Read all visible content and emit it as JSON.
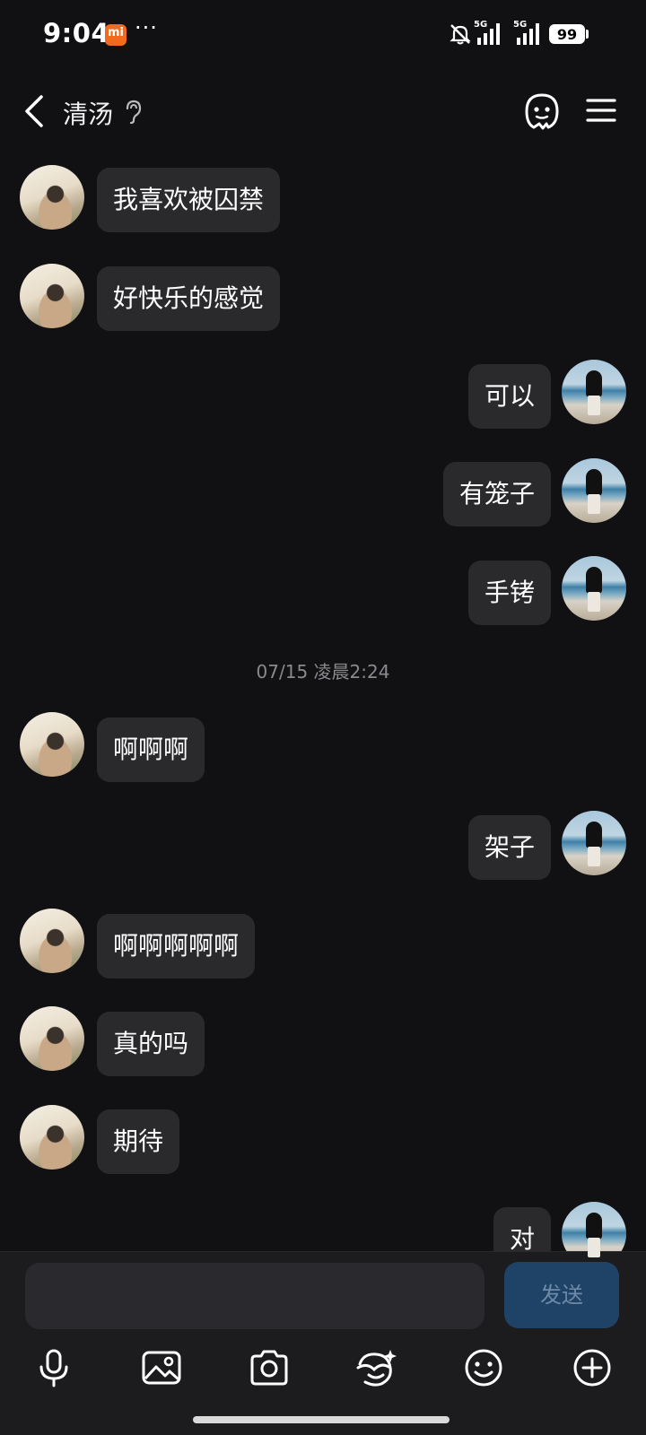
{
  "status_bar": {
    "time": "9:04",
    "carrier_badge": "mi",
    "more": "···",
    "network_1": "5G",
    "network_2": "5G",
    "battery": "99"
  },
  "header": {
    "back_icon": "chevron-left-icon",
    "title": "清汤",
    "ear_icon": "ear-icon",
    "ghost_icon": "ghost-icon",
    "menu_icon": "menu-icon"
  },
  "messages": [
    {
      "side": "left",
      "text": "我喜欢被囚禁"
    },
    {
      "side": "left",
      "text": "好快乐的感觉"
    },
    {
      "side": "right",
      "text": "可以"
    },
    {
      "side": "right",
      "text": "有笼子"
    },
    {
      "side": "right",
      "text": "手铐"
    },
    {
      "side": "timestamp",
      "text": "07/15 凌晨2:24"
    },
    {
      "side": "left",
      "text": "啊啊啊"
    },
    {
      "side": "right",
      "text": "架子"
    },
    {
      "side": "left",
      "text": "啊啊啊啊啊"
    },
    {
      "side": "left",
      "text": "真的吗"
    },
    {
      "side": "left",
      "text": "期待"
    },
    {
      "side": "right",
      "text": "对"
    }
  ],
  "composer": {
    "input_value": "",
    "send_label": "发送"
  },
  "toolbar": [
    "mic-icon",
    "image-icon",
    "camera-icon",
    "sticker-icon",
    "emoji-icon",
    "plus-icon"
  ],
  "colors": {
    "background": "#111114",
    "bubble": "#2a2a2d",
    "send_button": "#1e4366",
    "accent_badge": "#f26a1b"
  }
}
